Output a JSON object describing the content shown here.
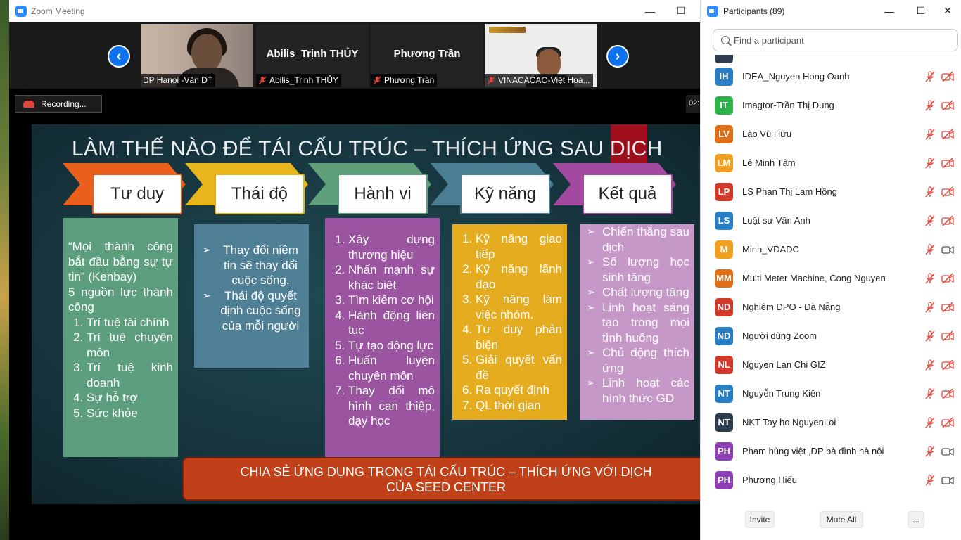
{
  "zoom_window": {
    "title": "Zoom Meeting",
    "controls": {
      "minimize": "—",
      "maximize": "☐"
    }
  },
  "thumbnails": [
    {
      "label": "DP Hanoi -Vân DT",
      "muted": false,
      "video": "person"
    },
    {
      "label": "Abilis_Trịnh THỦY",
      "big_name": "Abilis_Trịnh THỦY",
      "muted": true
    },
    {
      "label": "Phương Trần",
      "big_name": "Phương Trần",
      "muted": true
    },
    {
      "label": "VINACACAO-Việt Hoà...",
      "muted": true,
      "video": "man"
    }
  ],
  "share": {
    "recording_label": "Recording...",
    "timer": "02:"
  },
  "slide": {
    "title": "LÀM THẾ NÀO ĐỂ TÁI CẤU TRÚC – THÍCH ỨNG SAU DỊCH",
    "steps": [
      "Tư duy",
      "Thái độ",
      "Hành vi",
      "Kỹ năng",
      "Kết quả"
    ],
    "colors": [
      "#e8601c",
      "#e8b61c",
      "#5fa07a",
      "#4a7f93",
      "#a34aa0"
    ],
    "col1": {
      "quote": "“Mọi thành công bắt đầu bằng sự tự tin” (Kenbay)",
      "sub": "5 nguồn lực thành công",
      "items": [
        "Trí tuệ tài chính",
        "Trí tuệ chuyên môn",
        "Trí tuệ kinh doanh",
        "Sự hỗ trợ",
        "Sức khỏe"
      ]
    },
    "col2": {
      "items": [
        "Thay đổi niềm tin sẽ thay đổi cuộc sống.",
        "Thái độ quyết định cuộc sống của mỗi người"
      ]
    },
    "col3": {
      "items": [
        "Xây dựng thương hiệu",
        "Nhấn mạnh sự khác biệt",
        "Tìm kiếm cơ hội",
        "Hành động liên tục",
        "Tự tạo động lực",
        "Huấn luyện chuyên môn",
        "Thay đổi mô hình can thiệp, dạy học"
      ]
    },
    "col4": {
      "items": [
        "Kỹ năng giao tiếp",
        "Kỹ năng lãnh đạo",
        "Kỹ năng làm việc nhóm.",
        "Tư duy phản biện",
        "Giải quyết vấn đề",
        "Ra quyết định",
        "QL thời gian"
      ]
    },
    "col5": {
      "items": [
        "Chiến thắng sau dịch",
        "Số lượng học sinh tăng",
        "Chất lượng tăng",
        "Linh hoạt sáng tạo trong mọi tình huống",
        "Chủ động thích ứng",
        "Linh hoạt các hình thức GD"
      ]
    },
    "banner": [
      "CHIA SẺ ỨNG DỤNG TRONG TÁI CẤU TRÚC – THÍCH ỨNG VỚI DỊCH",
      "CỦA SEED CENTER"
    ]
  },
  "participants_panel": {
    "title": "Participants (89)",
    "search_placeholder": "Find a participant",
    "list": [
      {
        "initials": "IH",
        "name": "IDEA_Nguyen Hong Oanh",
        "color": "#2a7fc4",
        "cam": "off"
      },
      {
        "initials": "IT",
        "name": "Imagtor-Trần Thị Dung",
        "color": "#2eb24a",
        "cam": "off"
      },
      {
        "initials": "LV",
        "name": "Lào Vũ Hữu",
        "color": "#e07018",
        "cam": "off"
      },
      {
        "initials": "LM",
        "name": "Lê Minh Tâm",
        "color": "#f0a020",
        "cam": "off"
      },
      {
        "initials": "LP",
        "name": "LS Phan Thị Lam Hồng",
        "color": "#d03a2a",
        "cam": "off"
      },
      {
        "initials": "LS",
        "name": "Luật sư Vân Anh",
        "color": "#2a7fc4",
        "cam": "off"
      },
      {
        "initials": "M",
        "name": "Minh_VDADC",
        "color": "#f0a020",
        "cam": "on"
      },
      {
        "initials": "MM",
        "name": "Multi Meter Machine, Cong Nguyen",
        "color": "#e07018",
        "cam": "off"
      },
      {
        "initials": "ND",
        "name": "Nghiêm DPO - Đà Nẵng",
        "color": "#d03a2a",
        "cam": "off"
      },
      {
        "initials": "ND",
        "name": "Người dùng Zoom",
        "color": "#2a7fc4",
        "cam": "off"
      },
      {
        "initials": "NL",
        "name": "Nguyen Lan Chi GIZ",
        "color": "#d03a2a",
        "cam": "off"
      },
      {
        "initials": "NT",
        "name": "Nguyễn Trung Kiên",
        "color": "#2a7fc4",
        "cam": "off"
      },
      {
        "initials": "NT",
        "name": "NKT Tay ho NguyenLoi",
        "color": "#2f3e4e",
        "cam": "off"
      },
      {
        "initials": "PH",
        "name": "Phạm hùng việt ,DP bà đình hà nội",
        "color": "#8e3fb8",
        "cam": "on"
      },
      {
        "initials": "PH",
        "name": "Phương Hiếu",
        "color": "#8e3fb8",
        "cam": "on"
      }
    ],
    "footer": {
      "invite": "Invite",
      "mute_all": "Mute All",
      "more": "..."
    }
  }
}
